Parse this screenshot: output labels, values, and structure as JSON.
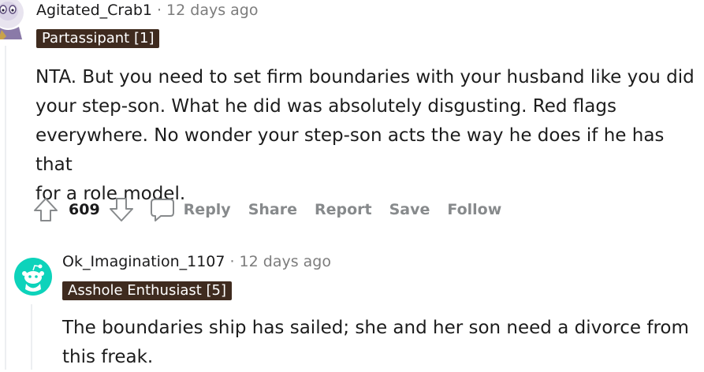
{
  "comments": [
    {
      "username": "Agitated_Crab1",
      "separator": "·",
      "timestamp": "12 days ago",
      "flair": "Partassipant [1]",
      "body_lines": [
        "NTA. But you need to set firm boundaries with your husband like you did",
        "your step-son. What he did was absolutely disgusting. Red flags",
        "everywhere. No wonder your step-son acts the way he does if he has that",
        "for a role model."
      ],
      "votes": "609",
      "actions": {
        "reply": "Reply",
        "share": "Share",
        "report": "Report",
        "save": "Save",
        "follow": "Follow"
      }
    },
    {
      "username": "Ok_Imagination_1107",
      "separator": "·",
      "timestamp": "12 days ago",
      "flair": "Asshole Enthusiast [5]",
      "body_lines": [
        "The boundaries ship has sailed; she and her son need a divorce from",
        "this freak."
      ]
    }
  ],
  "colors": {
    "flair_bg": "#3f2b1f",
    "avatar_teal": "#0dd3bb",
    "meta_gray": "#7c7c7c",
    "action_gray": "#878a8c"
  },
  "icons": [
    "upvote-icon",
    "downvote-icon",
    "comment-icon",
    "avatar-icon",
    "snoo-avatar-icon"
  ]
}
